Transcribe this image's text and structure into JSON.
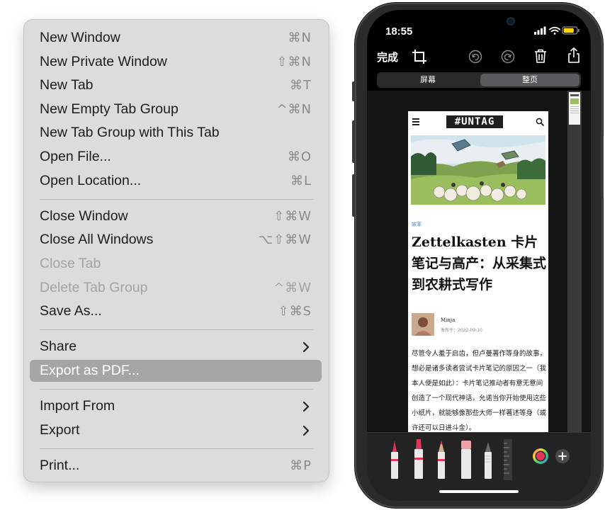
{
  "menu": {
    "groups": [
      [
        {
          "label": "New Window",
          "shortcut": "⌘N"
        },
        {
          "label": "New Private Window",
          "shortcut": "⇧⌘N"
        },
        {
          "label": "New Tab",
          "shortcut": "⌘T"
        },
        {
          "label": "New Empty Tab Group",
          "shortcut": "^⌘N"
        },
        {
          "label": "New Tab Group with This Tab",
          "shortcut": ""
        },
        {
          "label": "Open File...",
          "shortcut": "⌘O"
        },
        {
          "label": "Open Location...",
          "shortcut": "⌘L"
        }
      ],
      [
        {
          "label": "Close Window",
          "shortcut": "⇧⌘W"
        },
        {
          "label": "Close All Windows",
          "shortcut": "⌥⇧⌘W"
        },
        {
          "label": "Close Tab",
          "shortcut": "",
          "disabled": true
        },
        {
          "label": "Delete Tab Group",
          "shortcut": "^⌘W",
          "disabled": true
        },
        {
          "label": "Save As...",
          "shortcut": "⇧⌘S"
        }
      ],
      [
        {
          "label": "Share",
          "submenu": true
        },
        {
          "label": "Export as PDF...",
          "highlighted": true
        }
      ],
      [
        {
          "label": "Import From",
          "submenu": true
        },
        {
          "label": "Export",
          "submenu": true
        }
      ],
      [
        {
          "label": "Print...",
          "shortcut": "⌘P"
        }
      ]
    ]
  },
  "phone": {
    "status_time": "18:55",
    "toolbar": {
      "done_label": "完成",
      "icons": [
        "crop-icon",
        "undo-icon",
        "redo-icon",
        "trash-icon",
        "share-icon"
      ]
    },
    "segments": [
      {
        "label": "屏幕",
        "active": false
      },
      {
        "label": "整页",
        "active": true
      }
    ],
    "page": {
      "site_logo": "#UNTAG",
      "category": "效率",
      "title": "Zettelkasten 卡片笔记与高产：从采集式到农耕式写作",
      "author": "Minja",
      "date": "发布于：2022-09-10",
      "body": "尽管令人羞于启齿，但卢曼著作等身的故事，想必是诸多读者尝试卡片笔记的原因之一（我本人便是如此）：卡片笔记推动者有意无意间创造了一个现代神话，允诺当你开始使用这些小纸片，就能够像那些大师一样著述等身（或许还可以日进斗金）。"
    },
    "markup_tools": [
      "pen-tool",
      "highlighter-tool",
      "pencil-tool",
      "eraser-tool",
      "lasso-tool",
      "ruler-tool"
    ],
    "colors": {
      "accent": "#e0365a",
      "menu_highlight": "#a3a5a7"
    }
  }
}
